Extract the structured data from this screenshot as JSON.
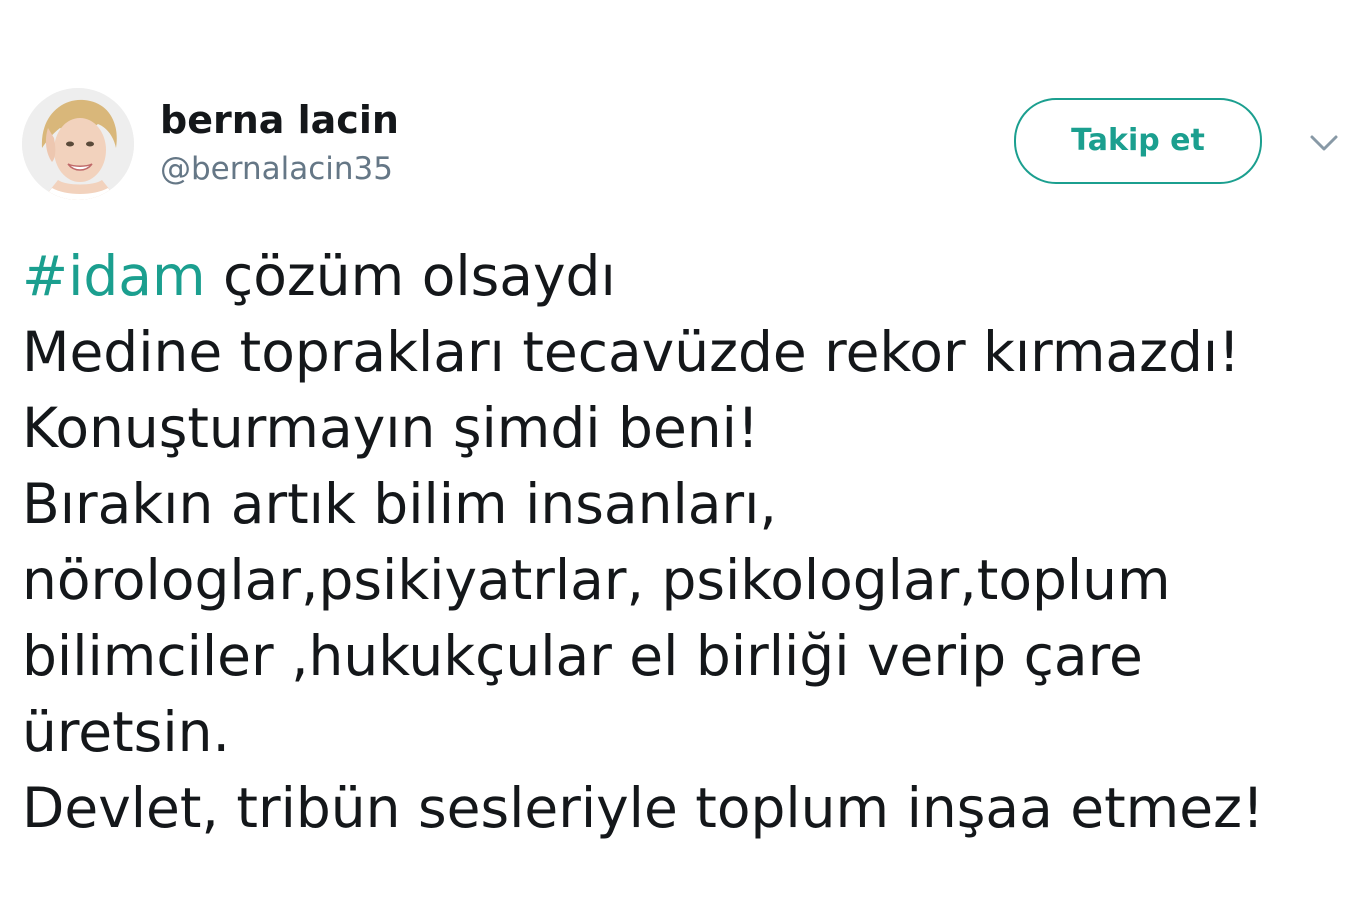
{
  "user": {
    "name": "berna lacin",
    "handle": "@bernalacin35"
  },
  "follow_button": {
    "label": "Takip et"
  },
  "menu": {
    "icon": "chevron-down-icon"
  },
  "tweet": {
    "hashtag": "#idam",
    "first_line_rest": " çözüm olsaydı",
    "lines": [
      "Medine toprakları tecavüzde rekor kırmazdı!",
      "Konuşturmayın şimdi beni!",
      "Bırakın artık bilim insanları,",
      "nörologlar,psikiyatrlar, psikologlar,toplum",
      "bilimciler ,hukukçular el birliği verip çare",
      "üretsin.",
      "Devlet, tribün sesleriyle toplum inşaa etmez!"
    ]
  },
  "colors": {
    "accent": "#1b9f8f",
    "text": "#14171a",
    "secondary": "#657786"
  }
}
